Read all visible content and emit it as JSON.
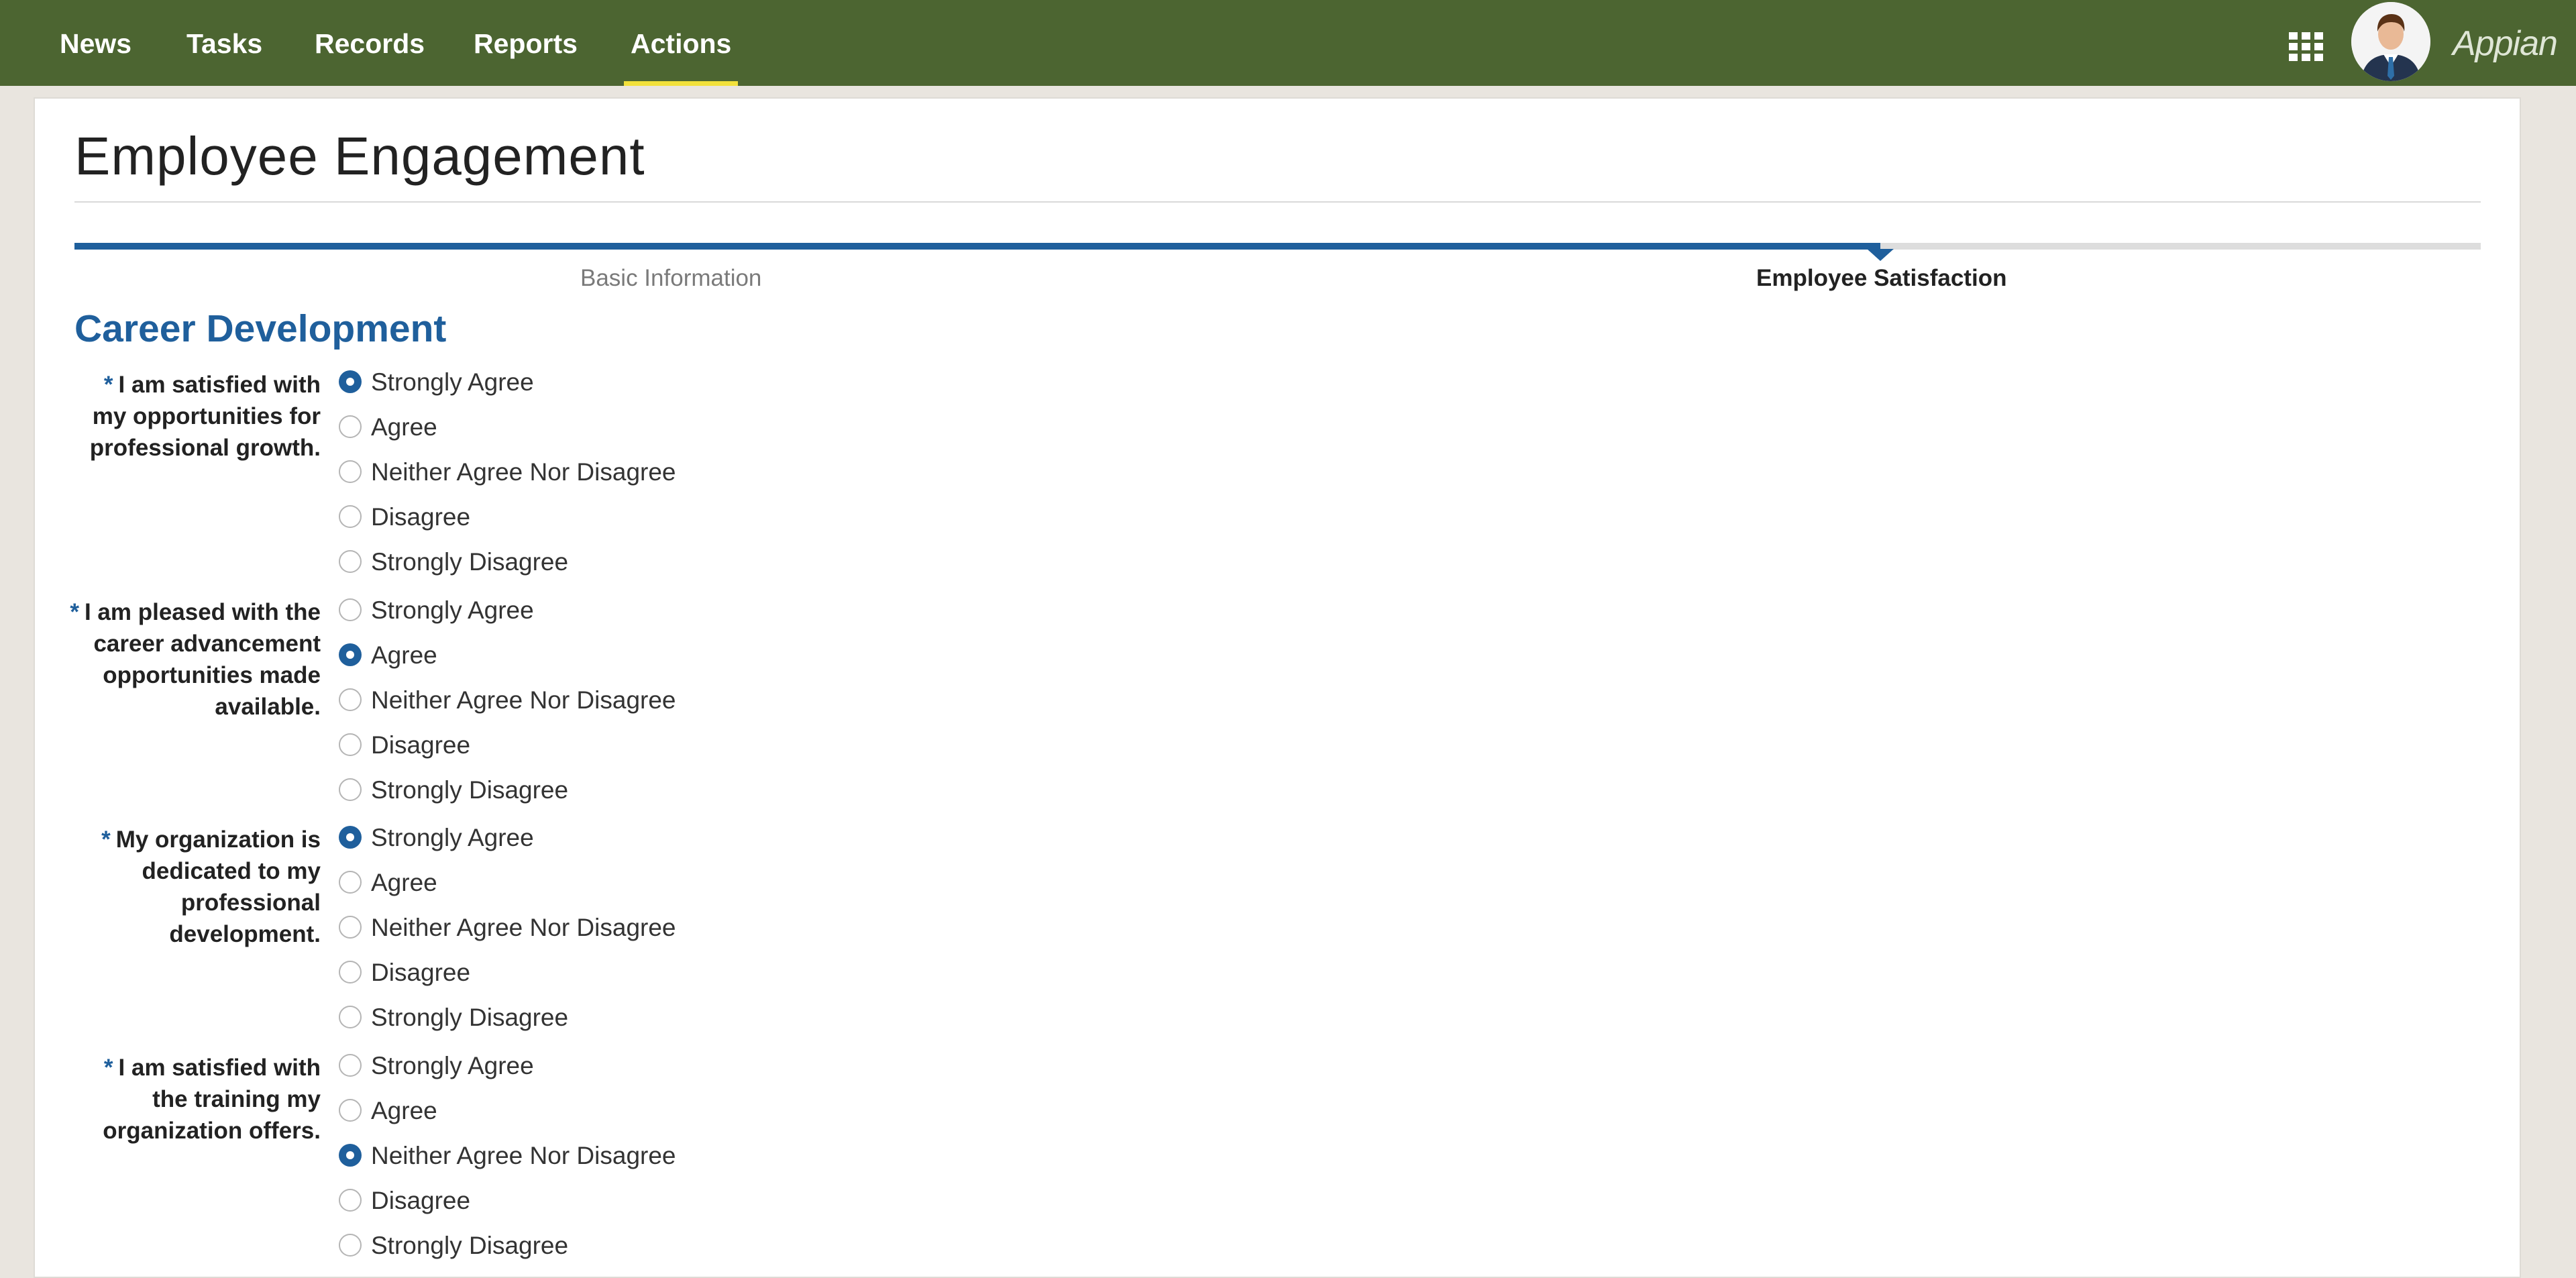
{
  "app": {
    "brand": "Appian",
    "nav": [
      {
        "label": "News",
        "active": false
      },
      {
        "label": "Tasks",
        "active": false
      },
      {
        "label": "Records",
        "active": false
      },
      {
        "label": "Reports",
        "active": false
      },
      {
        "label": "Actions",
        "active": true
      }
    ],
    "icons": {
      "apps": "grid-icon",
      "user": "avatar"
    }
  },
  "colors": {
    "nav_bg": "#4c6531",
    "nav_active_underline": "#f2e13b",
    "accent_blue": "#1f5f9c",
    "page_bg": "#e9e5df"
  },
  "page": {
    "title": "Employee Engagement",
    "steps": [
      {
        "label": "Basic Information",
        "state": "done"
      },
      {
        "label": "Employee Satisfaction",
        "state": "current"
      }
    ],
    "section_heading": "Career Development"
  },
  "form": {
    "required_marker": "*",
    "questions": [
      {
        "label": "I am satisfied with my opportunities for professional growth.",
        "options": [
          "Strongly Agree",
          "Agree",
          "Neither Agree Nor Disagree",
          "Disagree",
          "Strongly Disagree"
        ],
        "selected": "Strongly Agree"
      },
      {
        "label": "I am pleased with the career advancement opportunities made available.",
        "options": [
          "Strongly Agree",
          "Agree",
          "Neither Agree Nor Disagree",
          "Disagree",
          "Strongly Disagree"
        ],
        "selected": "Agree"
      },
      {
        "label": "My organization is dedicated to my professional development.",
        "options": [
          "Strongly Agree",
          "Agree",
          "Neither Agree Nor Disagree",
          "Disagree",
          "Strongly Disagree"
        ],
        "selected": "Strongly Agree"
      },
      {
        "label": "I am satisfied with the training my organization offers.",
        "options": [
          "Strongly Agree",
          "Agree",
          "Neither Agree Nor Disagree",
          "Disagree",
          "Strongly Disagree"
        ],
        "selected": "Neither Agree Nor Disagree"
      }
    ]
  }
}
